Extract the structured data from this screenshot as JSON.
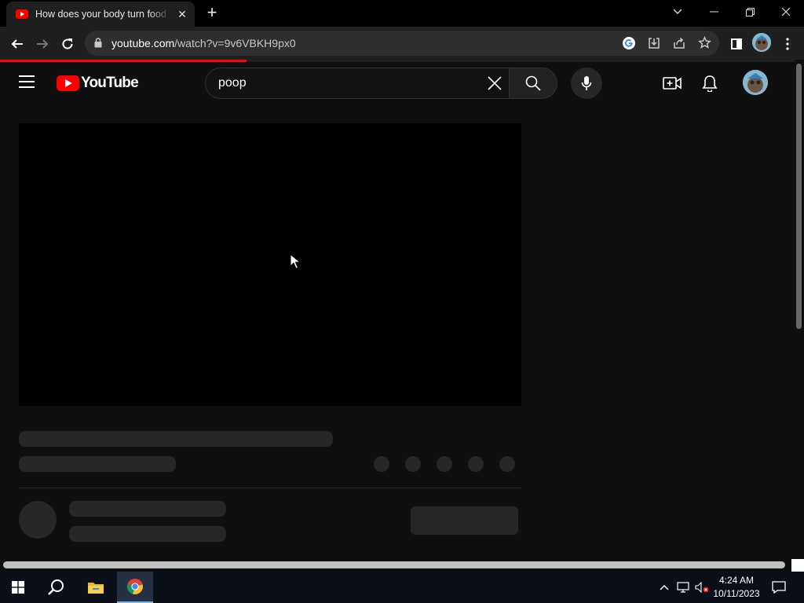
{
  "browser": {
    "tab": {
      "title": "How does your body turn food into poop",
      "close_glyph": "✕"
    },
    "new_tab_glyph": "+",
    "url": {
      "host": "youtube.com",
      "path": "/watch?v=9v6VBKH9px0"
    },
    "page_load_progress": 0.31
  },
  "youtube": {
    "logo_text": "YouTube",
    "search": {
      "query": "poop"
    }
  },
  "taskbar": {
    "time": "4:24 AM",
    "date": "10/11/2023"
  },
  "colors": {
    "youtube_red": "#ff0000",
    "page_bg": "#0f0f0f",
    "skeleton": "#272727",
    "taskbar_accent": "#76b9ed"
  },
  "icons": [
    "youtube-favicon",
    "chevron-down-icon",
    "minimize-icon",
    "restore-icon",
    "close-icon",
    "back-arrow-icon",
    "forward-arrow-icon",
    "reload-icon",
    "lock-icon",
    "google-lens-icon",
    "install-icon",
    "share-icon",
    "star-icon",
    "side-panel-icon",
    "profile-avatar",
    "kebab-menu-icon",
    "hamburger-menu-icon",
    "clear-search-icon",
    "search-icon",
    "microphone-icon",
    "create-video-icon",
    "bell-icon",
    "windows-start-icon",
    "search-taskbar-icon",
    "file-explorer-icon",
    "chrome-icon",
    "chevron-up-icon",
    "network-icon",
    "speaker-muted-icon",
    "notifications-icon",
    "mouse-cursor"
  ]
}
